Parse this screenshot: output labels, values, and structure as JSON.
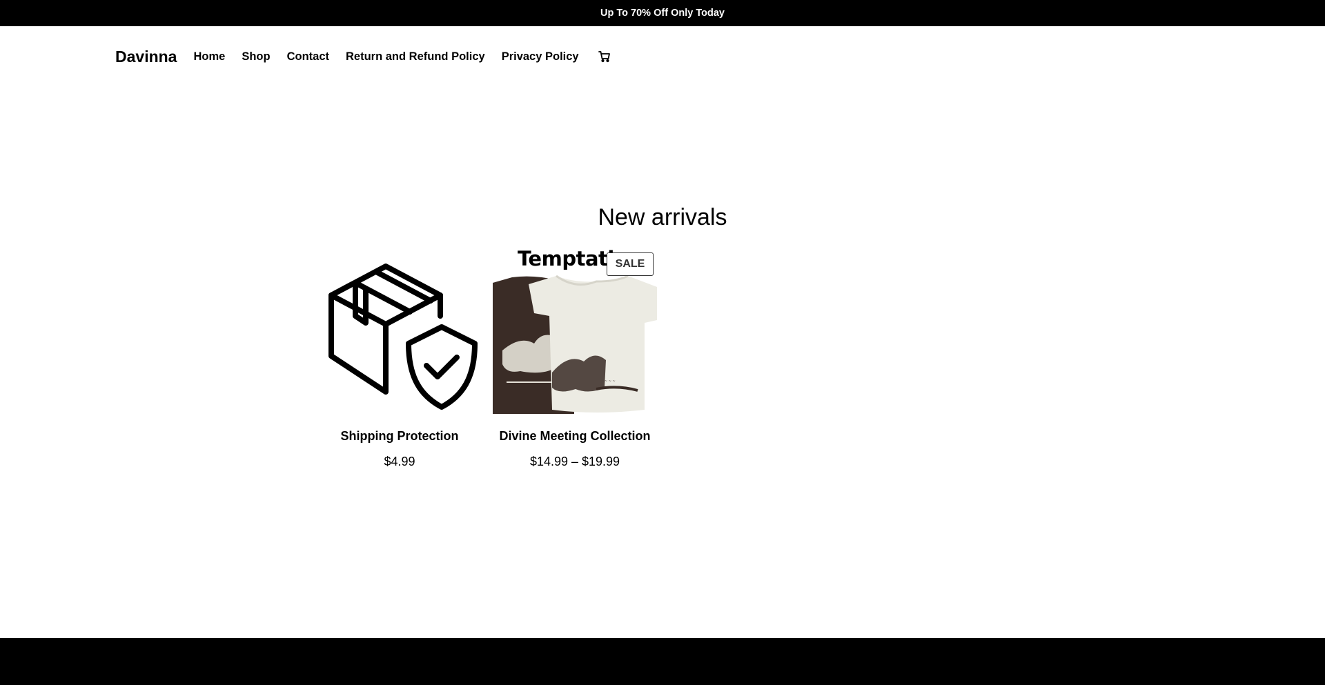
{
  "announcement": "Up To 70% Off Only Today",
  "header": {
    "brand": "Davinna",
    "nav": [
      "Home",
      "Shop",
      "Contact",
      "Return and Refund Policy",
      "Privacy Policy"
    ],
    "cart_icon": "cart-icon"
  },
  "section": {
    "title": "New arrivals"
  },
  "products": [
    {
      "name": "Shipping Protection",
      "price": "$4.99",
      "image_icon": "package-shield-icon"
    },
    {
      "name": "Divine Meeting Collection",
      "price": "$14.99 – $19.99",
      "badge": "SALE",
      "image_text": "Temptatio"
    }
  ],
  "colors": {
    "bar": "#000000",
    "text": "#000000",
    "background": "#ffffff",
    "tee_dark": "#3a2c26",
    "tee_light": "#ecebe3"
  }
}
